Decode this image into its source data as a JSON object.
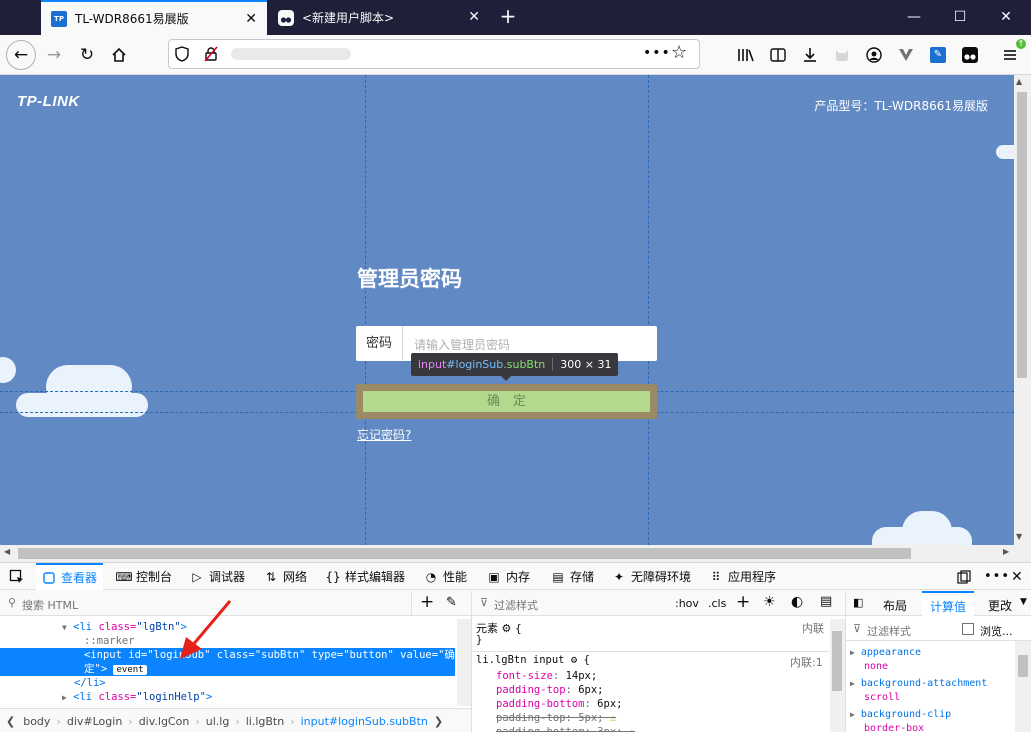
{
  "browser": {
    "tabs": [
      {
        "label": "TL-WDR8661易展版",
        "favicon": "TP"
      },
      {
        "label": "<新建用户脚本>"
      }
    ],
    "window_controls": [
      "minimize-icon",
      "maximize-icon",
      "close-icon"
    ]
  },
  "page": {
    "logo": "TP-LINK",
    "model_label": "产品型号：TL-WDR8661易展版",
    "heading": "管理员密码",
    "password_label": "密码",
    "password_placeholder": "请输入管理员密码",
    "submit_label": "确　定",
    "forgot_link": "忘记密码?",
    "inspector_tooltip": {
      "tag": "input",
      "id": "#loginSub",
      "class": ".subBtn",
      "size": "300 × 31"
    },
    "colors": {
      "background": "#6189c4",
      "highlight": "#b5d98c",
      "accent": "#0a84ff"
    }
  },
  "devtools": {
    "tabs": [
      "查看器",
      "控制台",
      "调试器",
      "网络",
      "样式编辑器",
      "性能",
      "内存",
      "存储",
      "无障碍环境",
      "应用程序"
    ],
    "search_placeholder": "搜索 HTML",
    "html_tree": {
      "line1_tag": "<li ",
      "line1_attr": "class=",
      "line1_val": "\"lgBtn\"",
      "line1_end": ">",
      "marker": "::marker",
      "sel_a": "<input ",
      "sel_id_attr": "id=",
      "sel_id_val": "\"loginSub\"",
      "sel_class_attr": " class=",
      "sel_class_val": "\"subBtn\"",
      "sel_type_attr": " type=",
      "sel_type_val": "\"button\"",
      "sel_value_attr": " value=",
      "sel_value_val": "\"确",
      "sel_value_val2": "定\"",
      "sel_end": ">",
      "event_badge": "event",
      "close_li": "</li>",
      "line_help_tag": "<li ",
      "line_help_attr": "class=",
      "line_help_val": "\"loginHelp\"",
      "line_help_end": ">"
    },
    "breadcrumbs": [
      "body",
      "div#Login",
      "div.lgCon",
      "ul.lg",
      "li.lgBtn",
      "input#loginSub.subBtn"
    ],
    "rules": {
      "filter_placeholder": "过滤样式",
      "hov": ":hov",
      "cls": ".cls",
      "element_label": "元素",
      "element_open": "{",
      "element_source": "内联",
      "element_close": "}",
      "selector": "li.lgBtn input",
      "selector_source": "内联:1",
      "declarations": [
        {
          "prop": "font-size",
          "value": "14px",
          "struck": false
        },
        {
          "prop": "padding-top",
          "value": "6px",
          "struck": false
        },
        {
          "prop": "padding-bottom",
          "value": "6px",
          "struck": false
        },
        {
          "prop": "padding-top",
          "value": "5px",
          "struck": true
        },
        {
          "prop": "padding-bottom",
          "value": "3px",
          "struck": true
        }
      ]
    },
    "computed": {
      "tabs": [
        "布局",
        "计算值",
        "更改"
      ],
      "filter_placeholder": "过滤样式",
      "browser_label": "浏览...",
      "props": [
        {
          "name": "appearance",
          "value": "none"
        },
        {
          "name": "background-attachment",
          "value": "scroll"
        },
        {
          "name": "background-clip",
          "value": "border-box"
        }
      ]
    }
  }
}
